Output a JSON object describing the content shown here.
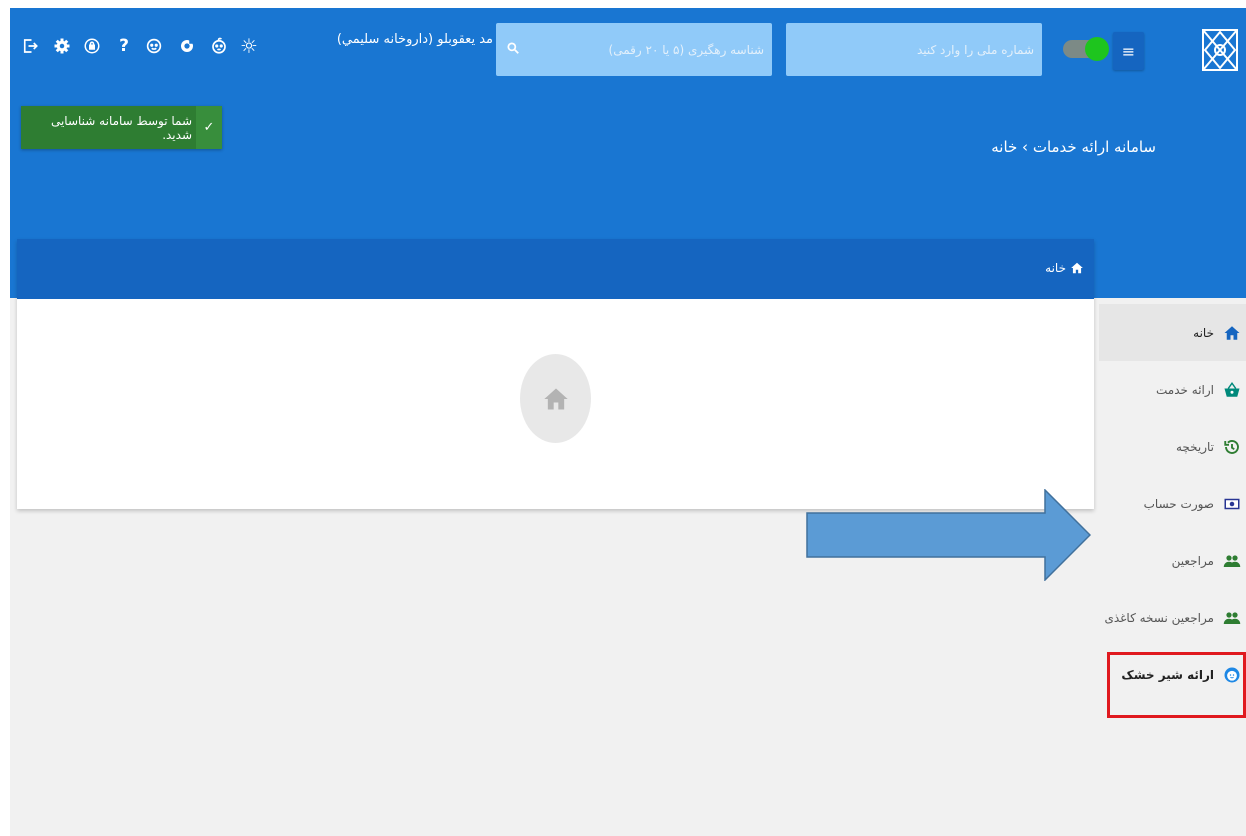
{
  "header": {
    "user_name": "مد يعقوبلو (داروخانه سليمي)",
    "tracking_placeholder": "شناسه رهگیری (۵ یا ۲۰ رقمی)",
    "national_placeholder": "شماره ملی را وارد کنید",
    "menu_glyph": "≡",
    "toggle_on": true,
    "breadcrumb": "سامانه ارائه خدمات › خانه",
    "toolbar_icons": [
      "logout-icon",
      "settings-icon",
      "security-icon",
      "help-icon",
      "child-icon",
      "refresh-icon",
      "baby-face-icon",
      "lightbulb-icon"
    ],
    "toolbar_glyphs": {
      "help": "?",
      "lightbulb": "☼"
    }
  },
  "toast": {
    "text": "شما توسط سامانه شناسایی شدید.",
    "check": "✓"
  },
  "card": {
    "title": "خانه"
  },
  "sidebar": {
    "items": [
      {
        "label": "خانه",
        "icon": "home-icon"
      },
      {
        "label": "ارائه خدمت",
        "icon": "basket-icon"
      },
      {
        "label": "تاریخچه",
        "icon": "history-icon"
      },
      {
        "label": "صورت حساب",
        "icon": "bill-icon"
      },
      {
        "label": "مراجعین",
        "icon": "people-icon"
      },
      {
        "label": "مراجعین نسخه کاغذی",
        "icon": "people-icon"
      },
      {
        "label": "ارائه شیر خشک",
        "icon": "baby-face-icon"
      }
    ]
  },
  "colors": {
    "header_bg": "#1976d2",
    "card_header_bg": "#1565c0",
    "toast_bg": "#2e7d32",
    "highlight": "#e0191f",
    "arrow_fill": "#5b9bd5"
  }
}
